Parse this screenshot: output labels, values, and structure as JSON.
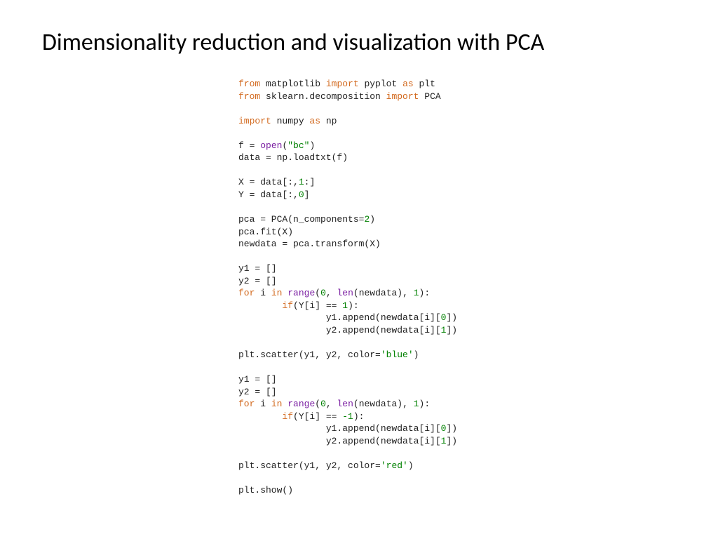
{
  "title": "Dimensionality reduction and visualization with PCA",
  "code": {
    "l01": "from matplotlib import pyplot as plt",
    "l02": "from sklearn.decomposition import PCA",
    "l03": "",
    "l04": "import numpy as np",
    "l05": "",
    "l06": "f = open(\"bc\")",
    "l07": "data = np.loadtxt(f)",
    "l08": "",
    "l09": "X = data[:,1:]",
    "l10": "Y = data[:,0]",
    "l11": "",
    "l12": "pca = PCA(n_components=2)",
    "l13": "pca.fit(X)",
    "l14": "newdata = pca.transform(X)",
    "l15": "",
    "l16": "y1 = []",
    "l17": "y2 = []",
    "l18": "for i in range(0, len(newdata), 1):",
    "l19": "        if(Y[i] == 1):",
    "l20": "                y1.append(newdata[i][0])",
    "l21": "                y2.append(newdata[i][1])",
    "l22": "",
    "l23": "plt.scatter(y1, y2, color='blue')",
    "l24": "",
    "l25": "y1 = []",
    "l26": "y2 = []",
    "l27": "for i in range(0, len(newdata), 1):",
    "l28": "        if(Y[i] == -1):",
    "l29": "                y1.append(newdata[i][0])",
    "l30": "                y2.append(newdata[i][1])",
    "l31": "",
    "l32": "plt.scatter(y1, y2, color='red')",
    "l33": "",
    "l34": "plt.show()"
  }
}
